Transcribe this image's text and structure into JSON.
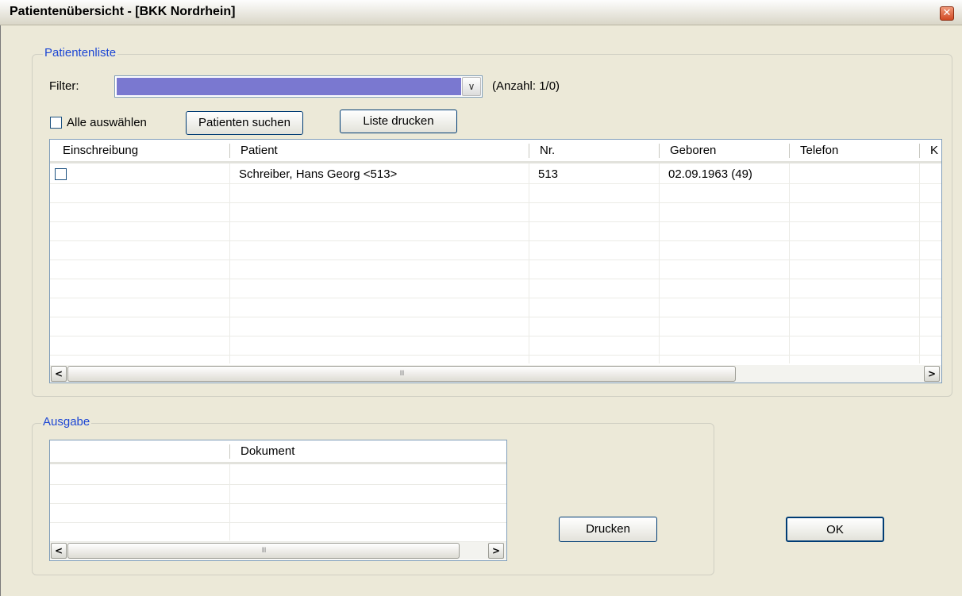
{
  "window": {
    "title": "Patientenübersicht - [BKK Nordrhein]",
    "close_symbol": "✕"
  },
  "patientenliste": {
    "legend": "Patientenliste",
    "filter_label": "Filter:",
    "filter_value": "",
    "count_text": "(Anzahl: 1/0)",
    "select_all_label": "Alle auswählen",
    "search_button": "Patienten suchen",
    "print_list_button": "Liste drucken",
    "columns": [
      "Einschreibung",
      "Patient",
      "Nr.",
      "Geboren",
      "Telefon",
      "K"
    ],
    "rows": [
      {
        "enrolled": false,
        "patient": "Schreiber,  Hans Georg <513>",
        "nr": "513",
        "born": "02.09.1963 (49)",
        "phone": "",
        "k": ""
      }
    ]
  },
  "ausgabe": {
    "legend": "Ausgabe",
    "columns": [
      "",
      "Dokument"
    ],
    "rows": []
  },
  "buttons": {
    "print": "Drucken",
    "ok": "OK"
  },
  "scroll": {
    "left": "<",
    "right": ">",
    "grip": "III"
  }
}
